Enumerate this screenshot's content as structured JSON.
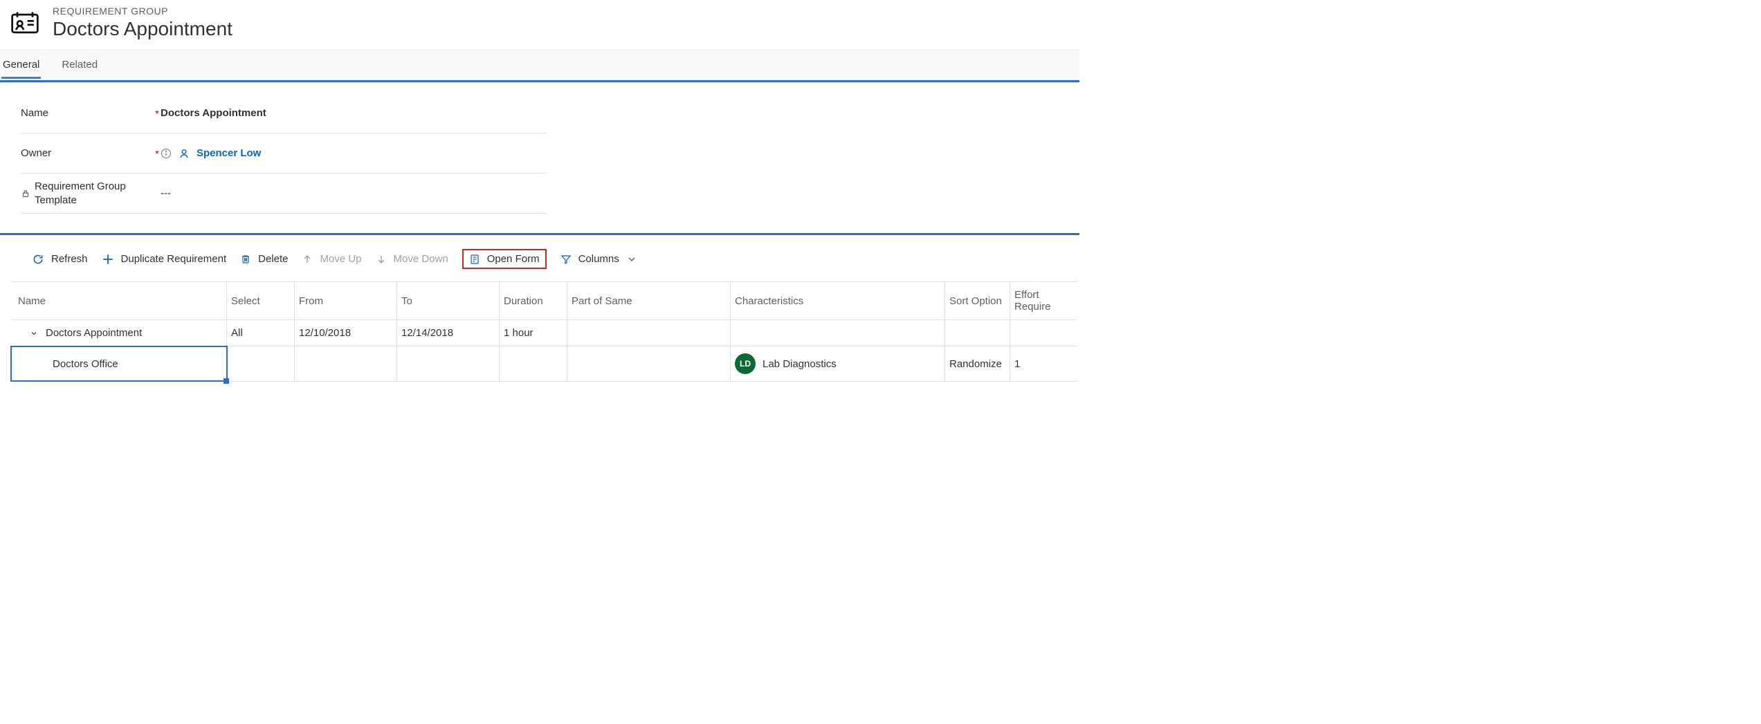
{
  "header": {
    "entity_type": "REQUIREMENT GROUP",
    "title": "Doctors Appointment"
  },
  "tabs": {
    "general": "General",
    "related": "Related"
  },
  "form": {
    "name_label": "Name",
    "name_value": "Doctors Appointment",
    "owner_label": "Owner",
    "owner_value": "Spencer Low",
    "template_label": "Requirement Group Template",
    "template_value": "---"
  },
  "toolbar": {
    "refresh": "Refresh",
    "duplicate": "Duplicate Requirement",
    "delete": "Delete",
    "move_up": "Move Up",
    "move_down": "Move Down",
    "open_form": "Open Form",
    "columns": "Columns"
  },
  "grid": {
    "headers": {
      "name": "Name",
      "select": "Select",
      "from": "From",
      "to": "To",
      "duration": "Duration",
      "pos": "Part of Same",
      "char": "Characteristics",
      "sort": "Sort Option",
      "effort": "Effort Require"
    },
    "rows": [
      {
        "name": "Doctors Appointment",
        "select": "All",
        "from": "12/10/2018",
        "to": "12/14/2018",
        "duration": "1 hour",
        "pos": "",
        "char": "",
        "char_avatar": "",
        "sort": "",
        "effort": ""
      },
      {
        "name": "Doctors Office",
        "select": "",
        "from": "",
        "to": "",
        "duration": "",
        "pos": "",
        "char": "Lab Diagnostics",
        "char_avatar": "LD",
        "sort": "Randomize",
        "effort": "1"
      }
    ]
  }
}
